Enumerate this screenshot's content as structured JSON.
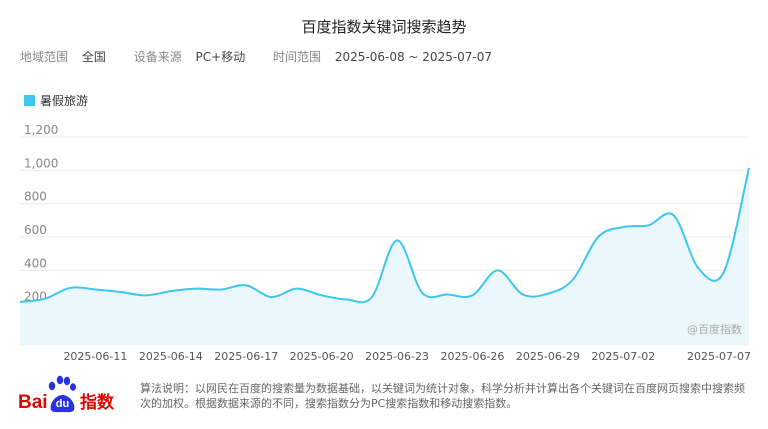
{
  "page": {
    "title": "百度指数关键词搜索趋势",
    "filters": [
      {
        "label": "地域范围",
        "value": "全国"
      },
      {
        "label": "设备来源",
        "value": "PC+移动"
      },
      {
        "label": "时间范围",
        "value": "2025-06-08 ~ 2025-07-07"
      }
    ],
    "watermark": "@百度指数",
    "footer_note": "算法说明：以网民在百度的搜索量为数据基础，以关键词为统计对象，科学分析并计算出各个关键词在百度网页搜索中搜索频次的加权。根据数据来源的不同，搜索指数分为PC搜索指数和移动搜索指数。",
    "logo": {
      "text_bai": "Bai",
      "text_du": "du",
      "text_zhishu": "指数",
      "icon": "baidu-paw-icon"
    }
  },
  "colors": {
    "line": "#3ec6ef",
    "fill": "#eaf8fd",
    "grid": "#ececec",
    "axis_text": "#888888",
    "logo_red": "#e10602",
    "logo_blue": "#2932e1"
  },
  "chart_data": {
    "type": "area",
    "title": "",
    "xlabel": "",
    "ylabel": "",
    "ylim": [
      0,
      1200
    ],
    "yticks": [
      200,
      400,
      600,
      800,
      1000,
      1200
    ],
    "ytick_labels": [
      "200",
      "400",
      "600",
      "800",
      "1,000",
      "1,200"
    ],
    "grid": true,
    "legend": "top-left",
    "x": [
      "2025-06-08",
      "2025-06-09",
      "2025-06-10",
      "2025-06-11",
      "2025-06-12",
      "2025-06-13",
      "2025-06-14",
      "2025-06-15",
      "2025-06-16",
      "2025-06-17",
      "2025-06-18",
      "2025-06-19",
      "2025-06-20",
      "2025-06-21",
      "2025-06-22",
      "2025-06-23",
      "2025-06-24",
      "2025-06-25",
      "2025-06-26",
      "2025-06-27",
      "2025-06-28",
      "2025-06-29",
      "2025-06-30",
      "2025-07-01",
      "2025-07-02",
      "2025-07-03",
      "2025-07-04",
      "2025-07-05",
      "2025-07-06",
      "2025-07-07"
    ],
    "xtick_labels": [
      "2025-06-11",
      "2025-06-14",
      "2025-06-17",
      "2025-06-20",
      "2025-06-23",
      "2025-06-26",
      "2025-06-29",
      "2025-07-02",
      "2025-07-07"
    ],
    "series": [
      {
        "name": "暑假旅游",
        "values": [
          210,
          230,
          295,
          285,
          270,
          250,
          275,
          290,
          285,
          310,
          240,
          290,
          250,
          225,
          240,
          580,
          265,
          255,
          250,
          400,
          255,
          260,
          345,
          600,
          660,
          670,
          730,
          410,
          390,
          1015
        ]
      }
    ]
  }
}
